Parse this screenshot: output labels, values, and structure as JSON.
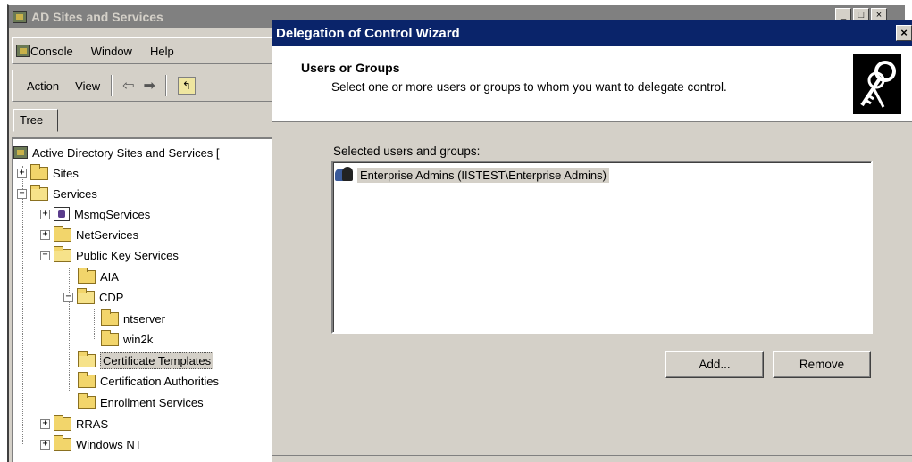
{
  "mmc": {
    "title": "AD Sites and Services",
    "menu": [
      "Console",
      "Window",
      "Help"
    ],
    "toolbar": {
      "action": "Action",
      "view": "View",
      "back_icon": "⇦",
      "forward_icon": "➡"
    },
    "tree_tab": "Tree",
    "tree": {
      "root": "Active Directory Sites and Services [",
      "sites": "Sites",
      "services": "Services",
      "msmq": "MsmqServices",
      "netservices": "NetServices",
      "pks": "Public Key Services",
      "aia": "AIA",
      "cdp": "CDP",
      "ntserver": "ntserver",
      "win2k": "win2k",
      "cert_templates": "Certificate Templates",
      "cert_authorities": "Certification Authorities",
      "enrollment": "Enrollment Services",
      "rras": "RRAS",
      "windows_nt": "Windows NT"
    }
  },
  "wizard": {
    "title": "Delegation of Control Wizard",
    "close": "×",
    "heading": "Users or Groups",
    "subheading": "Select one or more users or groups to whom you want to delegate control.",
    "list_label": "Selected users and groups:",
    "list_items": [
      "Enterprise Admins (IISTEST\\Enterprise Admins)"
    ],
    "add_button": "Add...",
    "remove_button": "Remove"
  }
}
